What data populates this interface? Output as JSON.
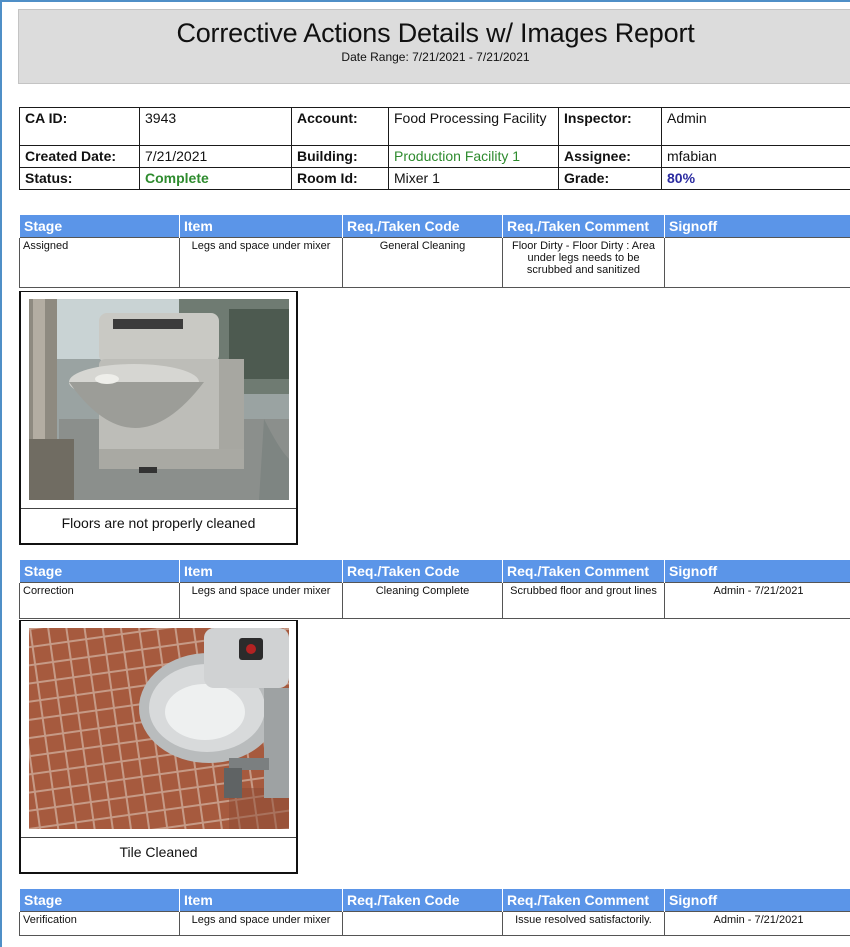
{
  "report": {
    "title": "Corrective Actions Details w/ Images Report",
    "date_range": "Date Range: 7/21/2021 - 7/21/2021"
  },
  "summary": {
    "ca_id_label": "CA ID:",
    "ca_id": "3943",
    "account_label": "Account:",
    "account": "Food Processing Facility",
    "inspector_label": "Inspector:",
    "inspector": "Admin",
    "created_date_label": "Created Date:",
    "created_date": "7/21/2021",
    "building_label": "Building:",
    "building": "Production Facility 1",
    "assignee_label": "Assignee:",
    "assignee": "mfabian",
    "status_label": "Status:",
    "status": "Complete",
    "room_label": "Room Id:",
    "room": "Mixer 1",
    "grade_label": "Grade:",
    "grade": "80%"
  },
  "columns": {
    "stage": "Stage",
    "item": "Item",
    "code": "Req./Taken Code",
    "comment": "Req./Taken Comment",
    "signoff": "Signoff"
  },
  "stages": [
    {
      "stage": "Assigned",
      "item": "Legs and space under mixer",
      "code": "General Cleaning",
      "comment": "Floor Dirty - Floor Dirty : Area under legs needs to be scrubbed and sanitized",
      "signoff": "",
      "image_caption": "Floors are not properly cleaned"
    },
    {
      "stage": "Correction",
      "item": "Legs and space under mixer",
      "code": "Cleaning Complete",
      "comment": "Scrubbed floor and grout lines",
      "signoff": "Admin - 7/21/2021",
      "image_caption": "Tile Cleaned"
    },
    {
      "stage": "Verification",
      "item": "Legs and space under mixer",
      "code": "",
      "comment": "Issue resolved satisfactorily.",
      "signoff": "Admin - 7/21/2021"
    }
  ],
  "colors": {
    "header_blue": "#5b95e8",
    "status_green": "#2e8b2e",
    "grade_navy": "#2a2aa0"
  }
}
